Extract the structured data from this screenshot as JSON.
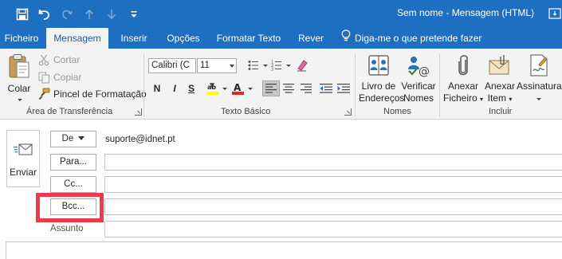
{
  "window": {
    "title": "Sem nome  -  Mensagem (HTML)"
  },
  "quick_access": {
    "items": [
      "save-icon",
      "undo-icon",
      "redo-icon",
      "up-arrow-icon",
      "down-arrow-icon",
      "customize-icon"
    ]
  },
  "tabs": [
    {
      "label": "Ficheiro",
      "active": false
    },
    {
      "label": "Mensagem",
      "active": true
    },
    {
      "label": "Inserir",
      "active": false
    },
    {
      "label": "Opções",
      "active": false
    },
    {
      "label": "Formatar Texto",
      "active": false
    },
    {
      "label": "Rever",
      "active": false
    }
  ],
  "tell_me": "Diga-me o que pretende fazer",
  "ribbon": {
    "clipboard": {
      "paste": "Colar",
      "cut": "Cortar",
      "copy": "Copiar",
      "format_painter": "Pincel de Formatação",
      "group": "Área de Transferência"
    },
    "basic_text": {
      "font": "Calibri (C",
      "size": "11",
      "bold": "N",
      "italic": "I",
      "underline": "S",
      "group": "Texto Básico"
    },
    "names": {
      "address_book_line1": "Livro de",
      "address_book_line2": "Endereços",
      "check_names_line1": "Verificar",
      "check_names_line2": "Nomes",
      "group": "Nomes"
    },
    "include": {
      "attach_file_line1": "Anexar",
      "attach_file_line2": "Ficheiro",
      "attach_item_line1": "Anexar",
      "attach_item_line2": "Item",
      "signature": "Assinatura",
      "group": "Incluir"
    }
  },
  "colors": {
    "brand": "#1e6fc1",
    "highlight": "#ea3b4f"
  },
  "compose": {
    "send": "Enviar",
    "from_button": "De",
    "from_address": "suporte@idnet.pt",
    "to_button": "Para...",
    "cc_button": "Cc...",
    "bcc_button": "Bcc...",
    "subject_label": "Assunto"
  }
}
